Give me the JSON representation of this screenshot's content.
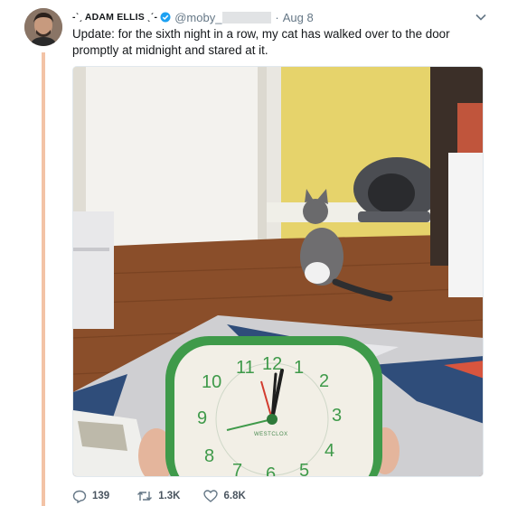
{
  "tweet": {
    "display_name": "-ˋˏ ADAM ELLIS ˎˊ-",
    "handle": "@moby_",
    "separator": "·",
    "date": "Aug 8",
    "text": "Update: for the sixth night in a row, my cat has walked over to the door promptly at midnight and stared at it."
  },
  "media": {
    "clock_numerals": [
      "12",
      "1",
      "2",
      "3",
      "4",
      "5",
      "6",
      "7",
      "8",
      "9",
      "10",
      "11"
    ],
    "clock_brand": "WESTCLOX"
  },
  "actions": {
    "replies": "139",
    "retweets": "1.3K",
    "likes": "6.8K"
  },
  "colors": {
    "thread_line": "#f3c3a6",
    "muted": "#657786",
    "verified": "#1da1f2",
    "wall": "#e6d36b",
    "clock_rim": "#3f9a4a"
  },
  "icons": {
    "verified": "verified-badge-icon",
    "caret": "chevron-down-icon",
    "reply": "reply-icon",
    "retweet": "retweet-icon",
    "like": "heart-icon"
  }
}
